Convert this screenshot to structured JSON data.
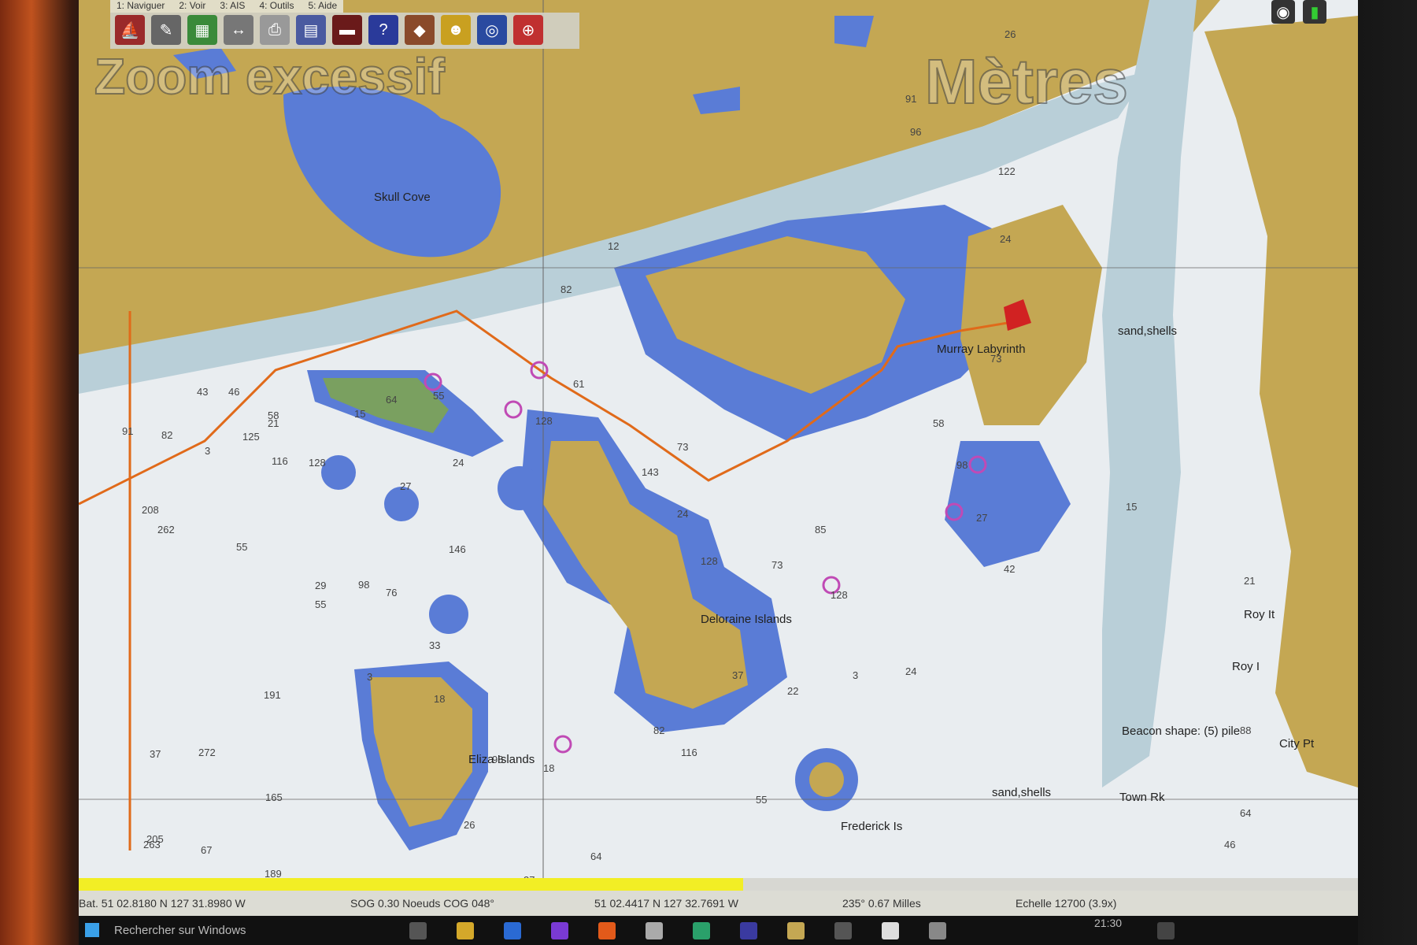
{
  "menu": [
    "1: Naviguer",
    "2: Voir",
    "3: AIS",
    "4: Outils",
    "5: Aide"
  ],
  "toolbar_icons": [
    "boat-icon",
    "pen-icon",
    "layers-icon",
    "route-icon",
    "print-icon",
    "grid-icon",
    "chart-icon",
    "help-icon",
    "palette-icon",
    "captain-icon",
    "globe-icon",
    "lifebuoy-icon"
  ],
  "overlay": {
    "zoom": "Zoom excessif",
    "units": "Mètres"
  },
  "labels": {
    "skull_cove": "Skull Cove",
    "murray": "Murray Labyrinth",
    "sand_shells_1": "sand,shells",
    "deloraine": "Deloraine Islands",
    "eliza": "Eliza Islands",
    "frederick": "Frederick Is",
    "beacon": "Beacon shape: (5) pile",
    "city_pt": "City Pt",
    "town_rk": "Town Rk",
    "sand_shells_2": "sand,shells",
    "roy_it": "Roy It",
    "roy_i": "Roy I"
  },
  "depths": [
    "26",
    "91",
    "96",
    "122",
    "24",
    "73",
    "58",
    "98",
    "27",
    "42",
    "15",
    "12",
    "82",
    "61",
    "73",
    "143",
    "24",
    "85",
    "128",
    "73",
    "128",
    "3",
    "24",
    "22",
    "37",
    "82",
    "116",
    "55",
    "18",
    "55",
    "64",
    "37",
    "189",
    "165",
    "37",
    "263",
    "191",
    "272",
    "208",
    "262",
    "55",
    "29",
    "146",
    "76",
    "33",
    "18",
    "98",
    "26",
    "55",
    "15",
    "21",
    "3",
    "43",
    "46",
    "82",
    "91",
    "125",
    "128",
    "58",
    "128",
    "116",
    "98",
    "27",
    "64",
    "24",
    "3",
    "21",
    "88",
    "46",
    "64",
    "67",
    "205"
  ],
  "status": {
    "position": "Bat. 51 02.8180 N   127 31.8980 W",
    "sog_cog": "SOG 0.30 Noeuds   COG 048°",
    "cursor": "51 02.4417 N    127 32.7691 W",
    "bearing": "235°  0.67 Milles",
    "scale": "Echelle 12700 (3.9x)",
    "progress": 0.52
  },
  "taskbar": {
    "search": "Rechercher sur Windows",
    "time": "21:30"
  },
  "colors": {
    "land": "#c7a955",
    "deep": "#e8ecef",
    "shallow": "#b9cfd8",
    "drying": "#6d9a5a",
    "navy": "#5a7cd6"
  }
}
